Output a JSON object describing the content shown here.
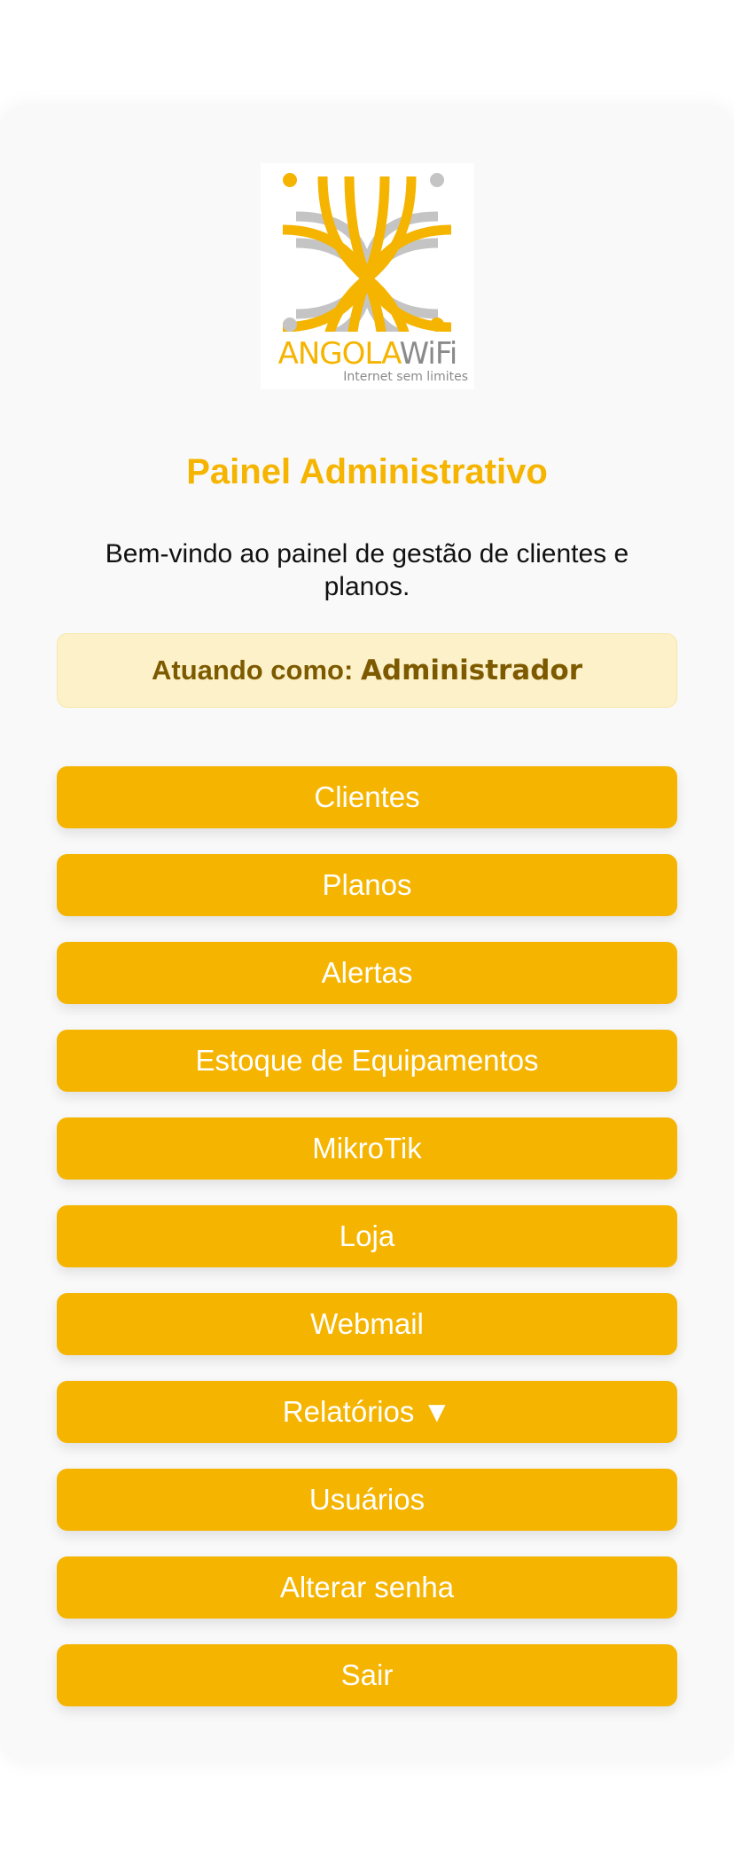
{
  "logo": {
    "brand_part1": "ANGOLA",
    "brand_part2": "WiFi",
    "tagline": "Internet sem limites",
    "colors": {
      "yellow": "#f5b400",
      "gray": "#bdbdbd"
    }
  },
  "header": {
    "title": "Painel Administrativo",
    "welcome": "Bem-vindo ao painel de gestão de clientes e planos."
  },
  "role": {
    "label": "Atuando como:",
    "value": "Administrador"
  },
  "nav": {
    "items": [
      {
        "label": "Clientes"
      },
      {
        "label": "Planos"
      },
      {
        "label": "Alertas"
      },
      {
        "label": "Estoque de Equipamentos"
      },
      {
        "label": "MikroTik"
      },
      {
        "label": "Loja"
      },
      {
        "label": "Webmail"
      },
      {
        "label": "Relatórios ▼"
      },
      {
        "label": "Usuários"
      },
      {
        "label": "Alterar senha"
      },
      {
        "label": "Sair"
      }
    ]
  },
  "colors": {
    "accent": "#f5b400",
    "role_bg": "#fdf1c9",
    "role_text": "#7d5a00",
    "card_bg": "#f9f9f9"
  }
}
